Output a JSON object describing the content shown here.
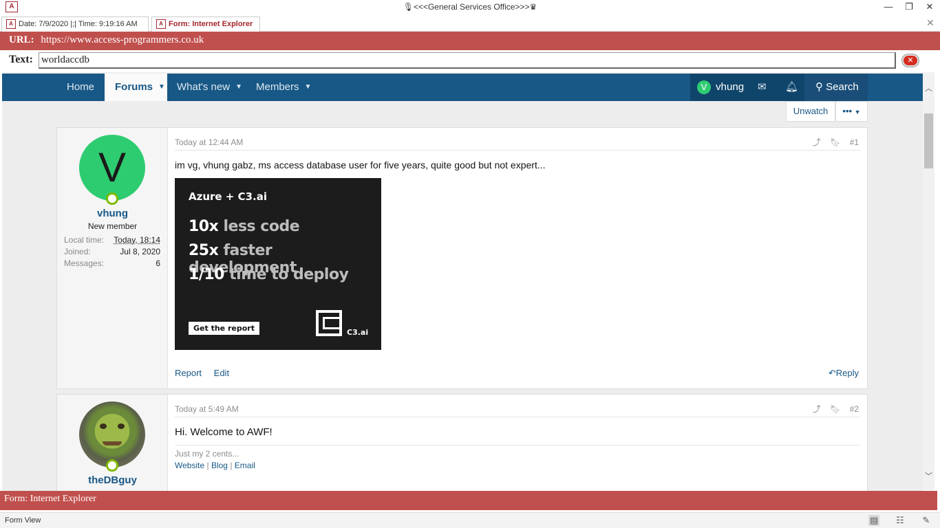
{
  "window": {
    "title": "🎙<<<General Services Office>>>♛",
    "minimize": "—",
    "restore": "❐",
    "close": "✕",
    "app_icon": "A"
  },
  "tabs": [
    {
      "label": "Date: 7/9/2020 |;| Time: 9:19:16 AM"
    },
    {
      "label": "Form: Internet Explorer"
    }
  ],
  "tab_close": "✕",
  "url": {
    "label": "URL:",
    "value": "https://www.access-programmers.co.uk"
  },
  "text": {
    "label": "Text:",
    "value": "worldaccdb",
    "clear": "✕"
  },
  "nav": {
    "home": "Home",
    "forums": "Forums",
    "whats_new": "What's new",
    "members": "Members",
    "user_initial": "V",
    "user": "vhung",
    "search": "Search"
  },
  "thread": {
    "unwatch": "Unwatch",
    "more": "•••"
  },
  "posts": [
    {
      "avatar_letter": "V",
      "username": "vhung",
      "user_title": "New member",
      "stats": [
        {
          "label": "Local time:",
          "value": "Today, 18:14"
        },
        {
          "label": "Joined:",
          "value": "Jul 8, 2020"
        },
        {
          "label": "Messages:",
          "value": "6"
        }
      ],
      "time": "Today at 12:44 AM",
      "number": "#1",
      "body": "im vg, vhung gabz, ms access database user for five years, quite good but not expert...",
      "ad": {
        "heading": "Azure + C3.ai",
        "lines": [
          {
            "num": "10x",
            "text": "less code"
          },
          {
            "num": "25x",
            "text": "faster development"
          },
          {
            "num": "1/10",
            "text": "time to deploy"
          }
        ],
        "cta": "Get the report",
        "brand": "C3.ai"
      },
      "actions": {
        "report": "Report",
        "edit": "Edit",
        "reply": "Reply"
      }
    },
    {
      "username": "theDBguy",
      "time": "Today at 5:49 AM",
      "number": "#2",
      "body": "Hi. Welcome to AWF!",
      "signature": "Just my 2 cents...",
      "links": {
        "website": "Website",
        "sep1": "|",
        "blog": "Blog",
        "sep2": "|",
        "email": "Email"
      }
    }
  ],
  "form_bar": "Form: Internet Explorer",
  "status": "Form View",
  "colors": {
    "accent_bar": "#c0504d",
    "forum_nav": "#185886",
    "link": "#185886"
  }
}
